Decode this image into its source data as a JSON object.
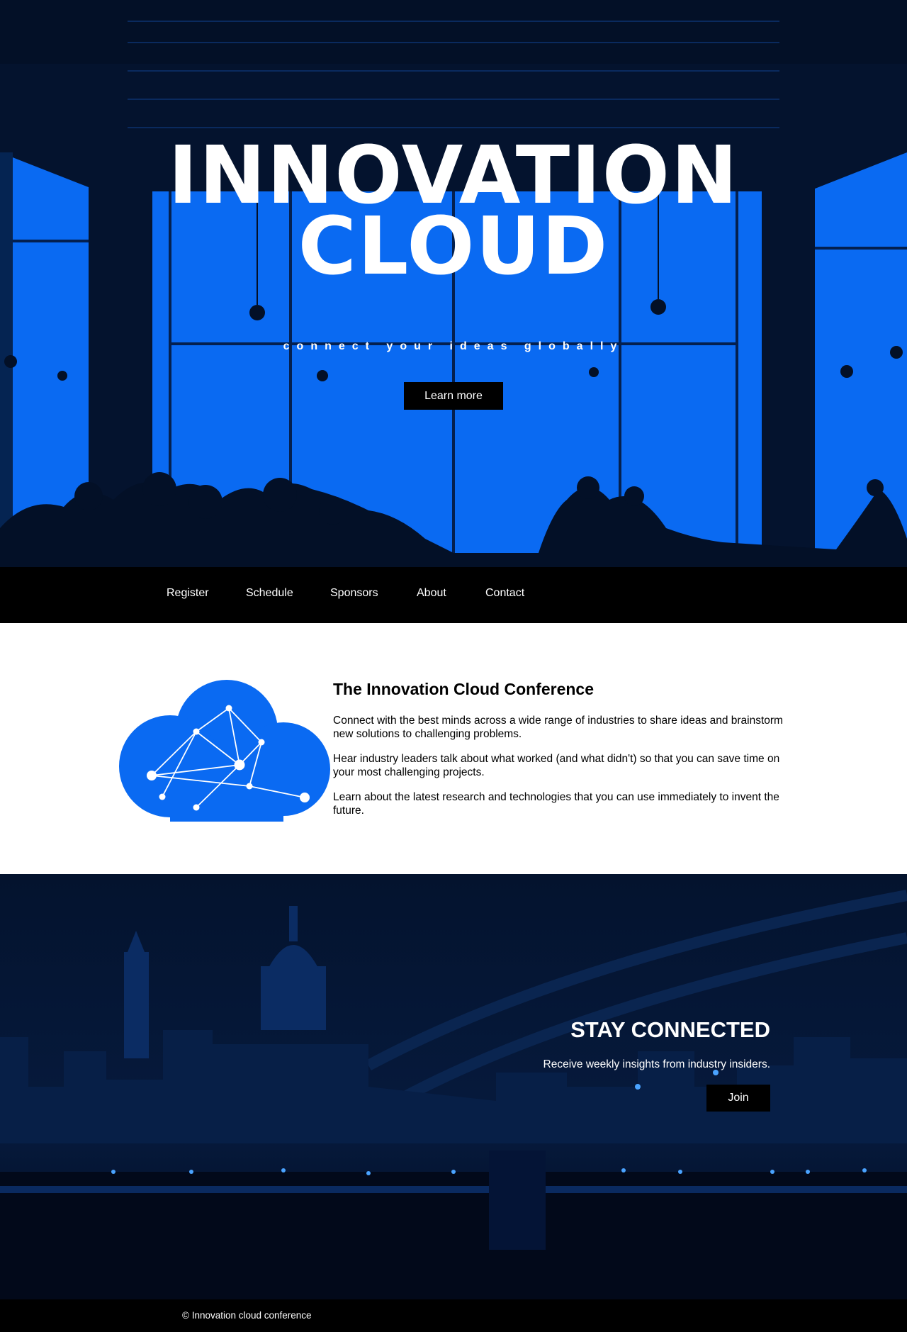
{
  "hero": {
    "title_line1": "INNOVATION",
    "title_line2": "CLOUD",
    "tagline": "connect your ideas globally",
    "button_label": "Learn more"
  },
  "nav": {
    "items": [
      {
        "label": "Register"
      },
      {
        "label": "Schedule"
      },
      {
        "label": "Sponsors"
      },
      {
        "label": "About"
      },
      {
        "label": "Contact"
      }
    ]
  },
  "intro": {
    "heading": "The Innovation Cloud Conference",
    "paragraphs": [
      "Connect with the best minds across a wide range of industries to share ideas and brainstorm new solutions to challenging problems.",
      "Hear industry leaders talk about what worked (and what didn't) so that you can save time on your most challenging projects.",
      "Learn about the latest research and technologies that you can use immediately to invent the future."
    ],
    "icon": "cloud-network-icon"
  },
  "stay": {
    "heading": "STAY CONNECTED",
    "text": "Receive weekly insights from industry insiders.",
    "button_label": "Join"
  },
  "footer": {
    "text": "© Innovation cloud conference"
  },
  "colors": {
    "brand_blue": "#0a6af2",
    "dark_navy": "#041028",
    "black": "#000000",
    "white": "#ffffff"
  }
}
